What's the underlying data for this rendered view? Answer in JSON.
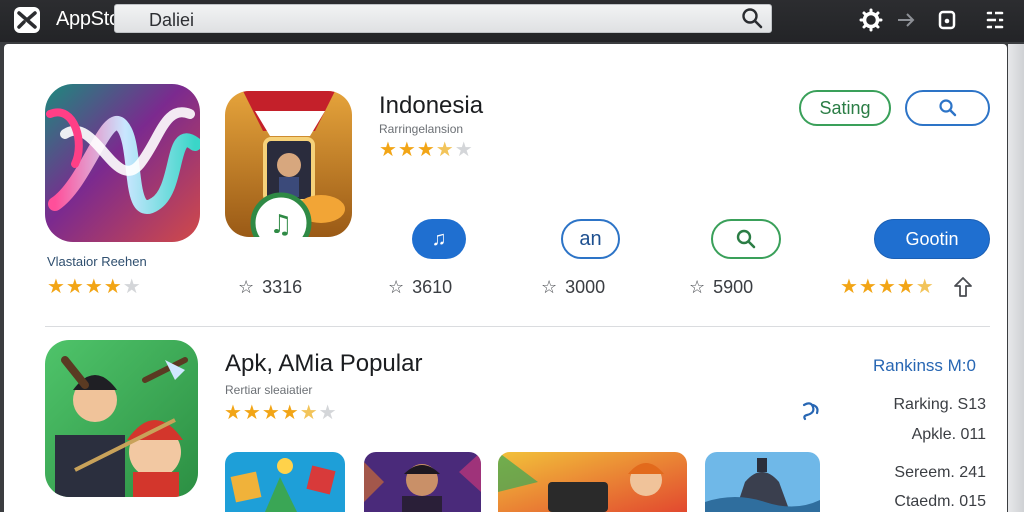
{
  "topbar": {
    "app_title": "AppStoe",
    "search_value": "Daliei",
    "icons": [
      "appstore-logo-icon",
      "search-icon",
      "gear-icon",
      "arrow-right-icon",
      "lock-icon",
      "menu-icon"
    ]
  },
  "featured": {
    "caption": "Vlastaior Reehen",
    "rating_stars": 4,
    "title": "Indonesia",
    "subtitle": "Rarringelansion",
    "title_rating_stars": 3.5,
    "buttons": {
      "sating_label": "Sating",
      "gootin_label": "Gootin",
      "round2_label": "an"
    },
    "right_rating_stars": 4.5,
    "counts": [
      "3316",
      "3610",
      "3000",
      "5900"
    ]
  },
  "popular": {
    "title": "Apk, AMia Popular",
    "subtitle": "Rertiar sleaiatier",
    "rating_stars": 4,
    "ranking_title": "Rankinss M:0",
    "ranking_lines": [
      "Rarking. S13",
      "Apkle. 011",
      "Sereem. 241",
      "Ctaedm. 015"
    ]
  },
  "colors": {
    "accent_blue": "#1f6fd0",
    "accent_green": "#3aa05a",
    "star": "#f2a516"
  }
}
